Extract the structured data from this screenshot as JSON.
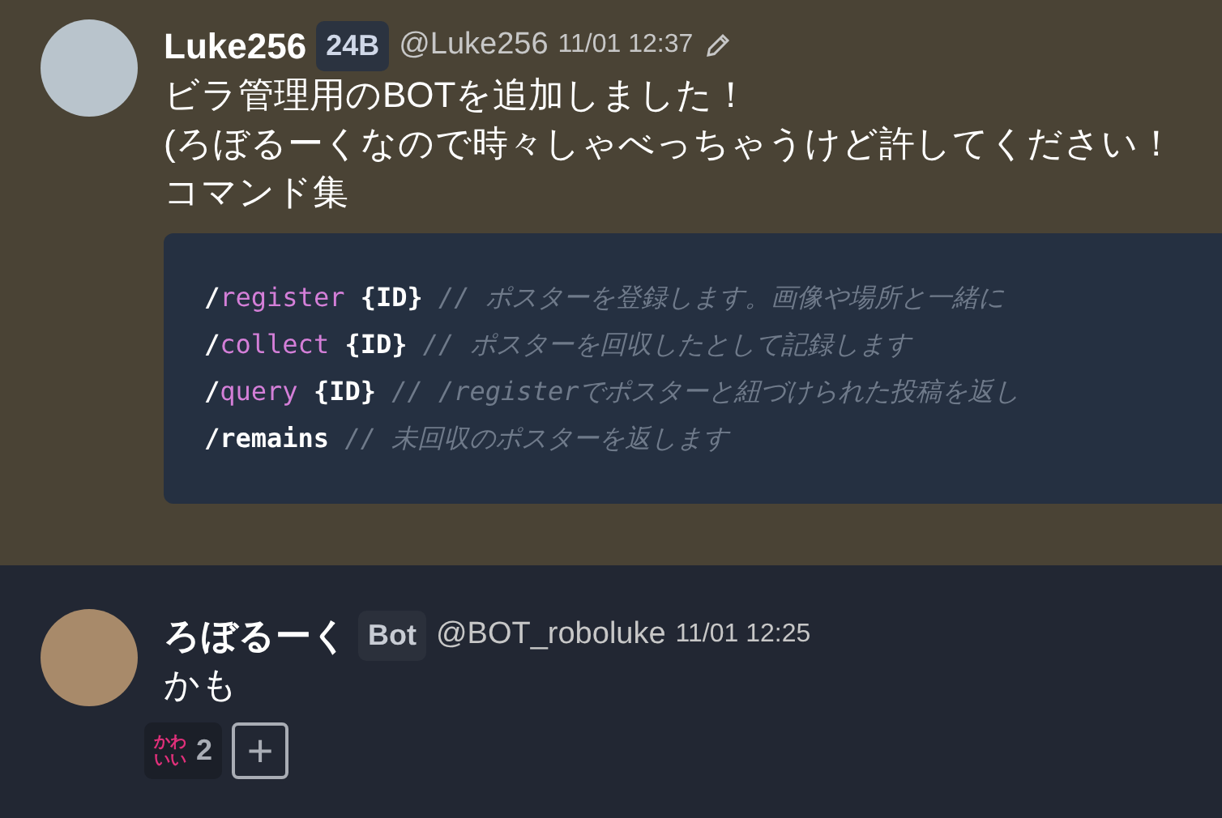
{
  "messages": [
    {
      "author": "Luke256",
      "badge": "24B",
      "handle": "@Luke256",
      "time": "11/01 12:37",
      "edited": true,
      "lines": [
        "ビラ管理用のBOTを追加しました！",
        "(ろぼるーくなので時々しゃべっちゃうけど許してください！",
        "コマンド集"
      ],
      "code": [
        [
          {
            "kind": "plain",
            "text": "/"
          },
          {
            "kind": "keyword",
            "text": "register"
          },
          {
            "kind": "plain",
            "text": " {ID}"
          },
          {
            "kind": "comment",
            "text": " // ポスターを登録します。画像や場所と一緒に"
          }
        ],
        [
          {
            "kind": "plain",
            "text": "/"
          },
          {
            "kind": "keyword",
            "text": "collect"
          },
          {
            "kind": "plain",
            "text": " {ID}"
          },
          {
            "kind": "comment",
            "text": " // ポスターを回収したとして記録します"
          }
        ],
        [
          {
            "kind": "plain",
            "text": "/"
          },
          {
            "kind": "keyword",
            "text": "query"
          },
          {
            "kind": "plain",
            "text": " {ID}"
          },
          {
            "kind": "comment",
            "text": " // /registerでポスターと紐づけられた投稿を返し"
          }
        ],
        [
          {
            "kind": "plain",
            "text": "/remains"
          },
          {
            "kind": "comment",
            "text": " // 未回収のポスターを返します"
          }
        ]
      ]
    },
    {
      "author": "ろぼるーく",
      "badge": "Bot",
      "handle": "@BOT_roboluke",
      "time": "11/01 12:25",
      "lines": [
        "かも"
      ],
      "reactions": [
        {
          "emoji": "かわいい",
          "count": "2"
        }
      ],
      "add_reaction": "+"
    }
  ]
}
